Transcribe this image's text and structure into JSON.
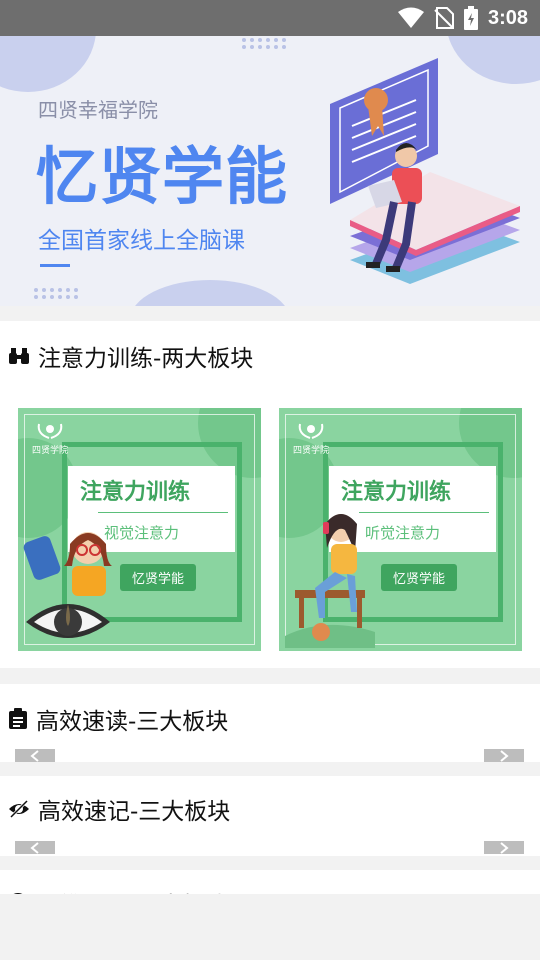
{
  "status_bar": {
    "time": "3:08",
    "icons": [
      "wifi-icon",
      "no-sim-icon",
      "battery-icon"
    ]
  },
  "banner": {
    "school_name": "四贤幸福学院",
    "title": "忆贤学能",
    "slogan": "全国首家线上全脑课",
    "colors": {
      "accent": "#4f86f0",
      "background": "#eef0f7"
    }
  },
  "sections": [
    {
      "icon": "binoculars-icon",
      "title": "注意力训练-两大板块",
      "cards": [
        {
          "logo_text": "四贤学院",
          "title": "注意力训练",
          "subtitle": "视觉注意力",
          "tag": "忆贤学能"
        },
        {
          "logo_text": "四贤学院",
          "title": "注意力训练",
          "subtitle": "听觉注意力",
          "tag": "忆贤学能"
        }
      ]
    },
    {
      "icon": "clipboard-icon",
      "title": "高效速读-三大板块"
    },
    {
      "icon": "eye-slash-icon",
      "title": "高效速记-三大板块"
    },
    {
      "icon": "globe-icon",
      "title": "思维导图-三大板块"
    }
  ],
  "colors": {
    "card_green": "#8ad4a0",
    "dark_green": "#3fa55f",
    "arrow_grey": "#bdbdbd"
  }
}
